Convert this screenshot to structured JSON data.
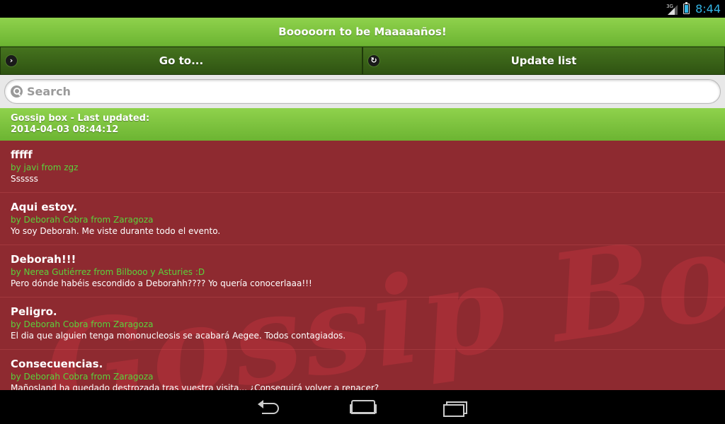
{
  "status": {
    "network": "3G",
    "time": "8:44",
    "accent_color": "#33b5e5"
  },
  "header": {
    "title": "Booooorn to be Maaaaaños!"
  },
  "nav": {
    "goto_label": "Go to...",
    "goto_icon": "chevron-right-icon",
    "update_label": "Update list",
    "update_icon": "refresh-icon"
  },
  "search": {
    "placeholder": "Search",
    "value": ""
  },
  "divider": {
    "line1": "Gossip box - Last updated:",
    "line2": "2014-04-03 08:44:12"
  },
  "list": {
    "watermark": "Gossip Box",
    "items": [
      {
        "title": "fffff",
        "author": "by javi from zgz",
        "body": "Ssssss"
      },
      {
        "title": "Aqui estoy.",
        "author": "by Deborah Cobra from Zaragoza",
        "body": "Yo soy Deborah. Me viste durante todo el evento."
      },
      {
        "title": "Deborah!!!",
        "author": "by Nerea Gutiérrez from Bilbooo y Asturies :D",
        "body": "Pero dónde habéis escondido a Deborahh???? Yo quería conocerlaaa!!!"
      },
      {
        "title": "Peligro.",
        "author": "by Deborah Cobra from Zaragoza",
        "body": "El dia que alguien tenga mononucleosis se acabará Aegee. Todos contagiados."
      },
      {
        "title": "Consecuencias.",
        "author": "by Deborah Cobra from Zaragoza",
        "body": "Mañosland ha quedado destrozada tras vuestra visita... ¿Conseguirá volver a renacer?"
      }
    ]
  },
  "colors": {
    "header_green": "#7dc33e",
    "nav_dark_green": "#3b6419",
    "list_bg": "#8e2a30",
    "author_green": "#5ad23c"
  }
}
